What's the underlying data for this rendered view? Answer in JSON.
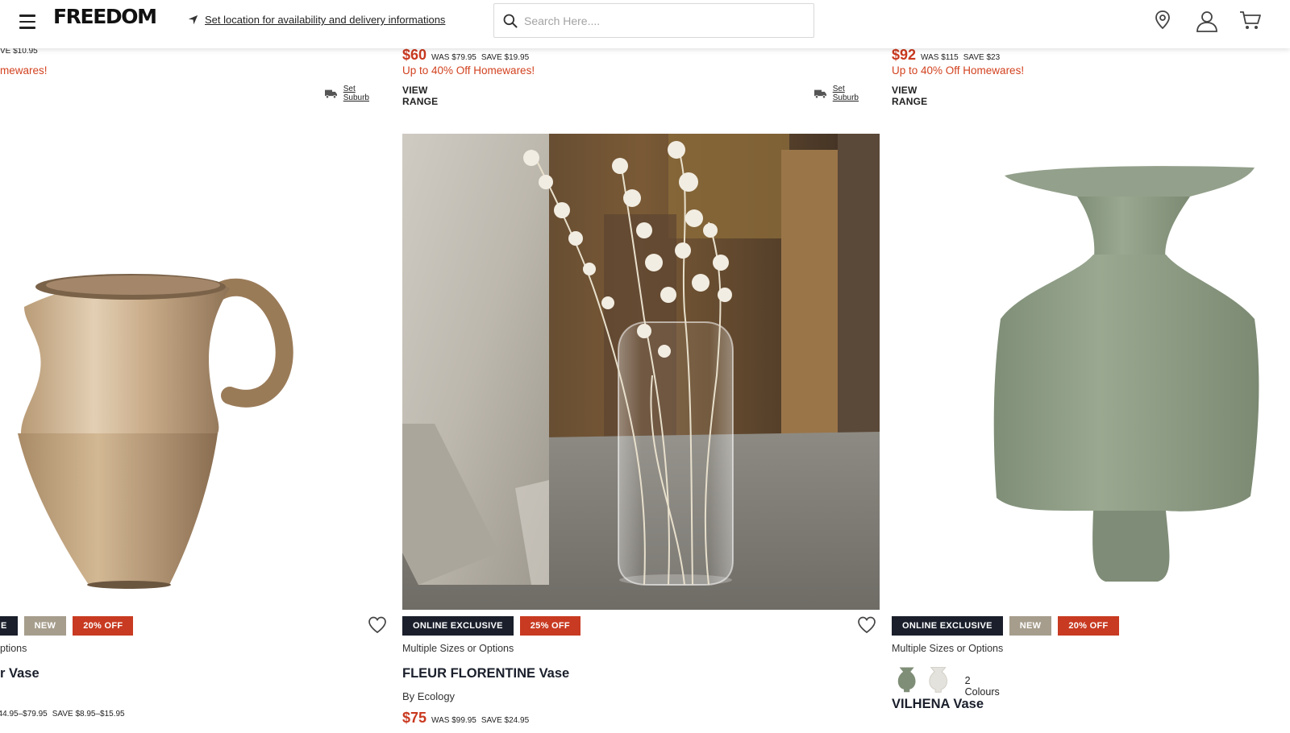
{
  "header": {
    "logo": "FREEDOM",
    "location_link": "Set location for availability and delivery informations",
    "search_placeholder": "Search Here...."
  },
  "products": [
    {
      "price": "",
      "was": "",
      "save": "VE $10.95",
      "promo": "mewares!",
      "set_suburb": "Set Suburb",
      "badges": [
        "E",
        "NEW",
        "20% OFF"
      ],
      "sizes": "ptions",
      "name": "r Vase",
      "bottom_price": "$44.95–$79.95",
      "bottom_save": "SAVE $8.95–$15.95"
    },
    {
      "price": "$60",
      "was": "WAS $79.95",
      "save": "SAVE $19.95",
      "promo": "Up to 40% Off Homewares!",
      "view_range": "VIEW RANGE",
      "set_suburb": "Set Suburb",
      "badges": [
        "ONLINE EXCLUSIVE",
        "25% OFF"
      ],
      "sizes": "Multiple Sizes or Options",
      "name": "FLEUR FLORENTINE Vase",
      "brand_by": "By",
      "brand": "Ecology",
      "bottom_price": "$75",
      "bottom_was": "WAS $99.95",
      "bottom_save": "SAVE $24.95"
    },
    {
      "price": "$92",
      "was": "WAS $115",
      "save": "SAVE $23",
      "promo": "Up to 40% Off Homewares!",
      "view_range": "VIEW RANGE",
      "badges": [
        "ONLINE EXCLUSIVE",
        "NEW",
        "20% OFF"
      ],
      "sizes": "Multiple Sizes or Options",
      "colours": "2 Colours",
      "name": "VILHENA Vase"
    }
  ],
  "colors": {
    "price_red": "#c9391f",
    "badge_dark": "#1a1f2b",
    "badge_new": "#a69d8c",
    "badge_off": "#c83a21",
    "vase_green": "#8f9d86"
  }
}
